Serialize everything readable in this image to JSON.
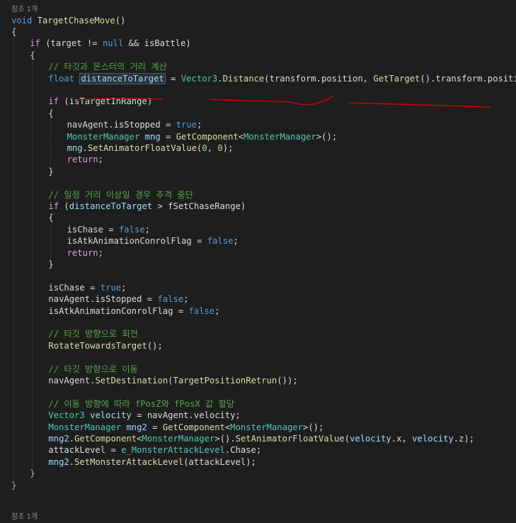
{
  "reference_labels": [
    "참조 1개",
    "참조 1개"
  ],
  "colors": {
    "background": "#1e1e1e",
    "keyword": "#569cd6",
    "control": "#d8a0df",
    "type": "#4ec9b0",
    "method": "#dcdcaa",
    "variable": "#9cdcfe",
    "comment": "#57a64a",
    "number": "#b5cea8",
    "annotation": "#e00000"
  },
  "lines": [
    {
      "indent": 0,
      "tokens": [
        [
          "kw",
          "void"
        ],
        [
          "plain",
          " "
        ],
        [
          "fn",
          "TargetChaseMove"
        ],
        [
          "plain",
          "()"
        ]
      ]
    },
    {
      "indent": 0,
      "tokens": [
        [
          "plain",
          "{"
        ]
      ]
    },
    {
      "indent": 1,
      "tokens": [
        [
          "ctl",
          "if"
        ],
        [
          "plain",
          " (target != "
        ],
        [
          "kw",
          "null"
        ],
        [
          "plain",
          " && isBattle)"
        ]
      ]
    },
    {
      "indent": 1,
      "tokens": [
        [
          "plain",
          "{"
        ]
      ]
    },
    {
      "indent": 2,
      "tokens": [
        [
          "cm",
          "// 타깃과 몬스터의 거리 계산"
        ]
      ]
    },
    {
      "indent": 2,
      "tokens": [
        [
          "kw",
          "float"
        ],
        [
          "plain",
          " "
        ],
        [
          "var",
          "distanceToTarget"
        ],
        [
          "plain",
          " = "
        ],
        [
          "type",
          "Vector3"
        ],
        [
          "plain",
          "."
        ],
        [
          "fn",
          "Distance"
        ],
        [
          "plain",
          "(transform.position, "
        ],
        [
          "fn",
          "GetTarget"
        ],
        [
          "plain",
          "().transform.position);"
        ]
      ]
    },
    {
      "indent": 2,
      "tokens": []
    },
    {
      "indent": 2,
      "tokens": [
        [
          "ctl",
          "if"
        ],
        [
          "plain",
          " (isTargetInRange)"
        ]
      ]
    },
    {
      "indent": 2,
      "tokens": [
        [
          "plain",
          "{"
        ]
      ]
    },
    {
      "indent": 3,
      "tokens": [
        [
          "plain",
          "navAgent.isStopped = "
        ],
        [
          "kw",
          "true"
        ],
        [
          "plain",
          ";"
        ]
      ]
    },
    {
      "indent": 3,
      "tokens": [
        [
          "type",
          "MonsterManager"
        ],
        [
          "plain",
          " "
        ],
        [
          "var",
          "mng"
        ],
        [
          "plain",
          " = "
        ],
        [
          "fn",
          "GetComponent"
        ],
        [
          "plain",
          "<"
        ],
        [
          "type",
          "MonsterManager"
        ],
        [
          "plain",
          ">();"
        ]
      ]
    },
    {
      "indent": 3,
      "tokens": [
        [
          "var",
          "mng"
        ],
        [
          "plain",
          "."
        ],
        [
          "fn",
          "SetAnimatorFloatValue"
        ],
        [
          "plain",
          "("
        ],
        [
          "num",
          "0"
        ],
        [
          "plain",
          ", "
        ],
        [
          "num",
          "0"
        ],
        [
          "plain",
          ");"
        ]
      ]
    },
    {
      "indent": 3,
      "tokens": [
        [
          "ctl",
          "return"
        ],
        [
          "plain",
          ";"
        ]
      ]
    },
    {
      "indent": 2,
      "tokens": [
        [
          "plain",
          "}"
        ]
      ]
    },
    {
      "indent": 2,
      "tokens": []
    },
    {
      "indent": 2,
      "tokens": [
        [
          "cm",
          "// 일정 거리 이상일 경우 추격 중단"
        ]
      ]
    },
    {
      "indent": 2,
      "tokens": [
        [
          "ctl",
          "if"
        ],
        [
          "plain",
          " ("
        ],
        [
          "var",
          "distanceToTarget"
        ],
        [
          "plain",
          " > fSetChaseRange)"
        ]
      ]
    },
    {
      "indent": 2,
      "tokens": [
        [
          "plain",
          "{"
        ]
      ]
    },
    {
      "indent": 3,
      "tokens": [
        [
          "plain",
          "isChase = "
        ],
        [
          "kw",
          "false"
        ],
        [
          "plain",
          ";"
        ]
      ]
    },
    {
      "indent": 3,
      "tokens": [
        [
          "plain",
          "isAtkAnimationConrolFlag = "
        ],
        [
          "kw",
          "false"
        ],
        [
          "plain",
          ";"
        ]
      ]
    },
    {
      "indent": 3,
      "tokens": [
        [
          "ctl",
          "return"
        ],
        [
          "plain",
          ";"
        ]
      ]
    },
    {
      "indent": 2,
      "tokens": [
        [
          "plain",
          "}"
        ]
      ]
    },
    {
      "indent": 2,
      "tokens": []
    },
    {
      "indent": 2,
      "tokens": [
        [
          "plain",
          "isChase = "
        ],
        [
          "kw",
          "true"
        ],
        [
          "plain",
          ";"
        ]
      ]
    },
    {
      "indent": 2,
      "tokens": [
        [
          "plain",
          "navAgent.isStopped = "
        ],
        [
          "kw",
          "false"
        ],
        [
          "plain",
          ";"
        ]
      ]
    },
    {
      "indent": 2,
      "tokens": [
        [
          "plain",
          "isAtkAnimationConrolFlag = "
        ],
        [
          "kw",
          "false"
        ],
        [
          "plain",
          ";"
        ]
      ]
    },
    {
      "indent": 2,
      "tokens": []
    },
    {
      "indent": 2,
      "tokens": [
        [
          "cm",
          "// 타깃 방향으로 회전"
        ]
      ]
    },
    {
      "indent": 2,
      "tokens": [
        [
          "fn",
          "RotateTowardsTarget"
        ],
        [
          "plain",
          "();"
        ]
      ]
    },
    {
      "indent": 2,
      "tokens": []
    },
    {
      "indent": 2,
      "tokens": [
        [
          "cm",
          "// 타깃 방향으로 이동"
        ]
      ]
    },
    {
      "indent": 2,
      "tokens": [
        [
          "plain",
          "navAgent."
        ],
        [
          "fn",
          "SetDestination"
        ],
        [
          "plain",
          "("
        ],
        [
          "fn",
          "TargetPositionRetrun"
        ],
        [
          "plain",
          "());"
        ]
      ]
    },
    {
      "indent": 2,
      "tokens": []
    },
    {
      "indent": 2,
      "tokens": [
        [
          "cm",
          "// 이동 방향에 따라 fPosZ와 fPosX 값 할당"
        ]
      ]
    },
    {
      "indent": 2,
      "tokens": [
        [
          "type",
          "Vector3"
        ],
        [
          "plain",
          " "
        ],
        [
          "var",
          "velocity"
        ],
        [
          "plain",
          " = navAgent.velocity;"
        ]
      ]
    },
    {
      "indent": 2,
      "tokens": [
        [
          "type",
          "MonsterManager"
        ],
        [
          "plain",
          " "
        ],
        [
          "var",
          "mng2"
        ],
        [
          "plain",
          " = "
        ],
        [
          "fn",
          "GetComponent"
        ],
        [
          "plain",
          "<"
        ],
        [
          "type",
          "MonsterManager"
        ],
        [
          "plain",
          ">();"
        ]
      ]
    },
    {
      "indent": 2,
      "tokens": [
        [
          "var",
          "mng2"
        ],
        [
          "plain",
          "."
        ],
        [
          "fn",
          "GetComponent"
        ],
        [
          "plain",
          "<"
        ],
        [
          "type",
          "MonsterManager"
        ],
        [
          "plain",
          ">()."
        ],
        [
          "fn",
          "SetAnimatorFloatValue"
        ],
        [
          "plain",
          "("
        ],
        [
          "var",
          "velocity"
        ],
        [
          "plain",
          ".x, "
        ],
        [
          "var",
          "velocity"
        ],
        [
          "plain",
          ".z);"
        ]
      ]
    },
    {
      "indent": 2,
      "tokens": [
        [
          "plain",
          "attackLevel = "
        ],
        [
          "type",
          "e_MonsterAttackLevel"
        ],
        [
          "plain",
          ".Chase;"
        ]
      ]
    },
    {
      "indent": 2,
      "tokens": [
        [
          "var",
          "mng2"
        ],
        [
          "plain",
          "."
        ],
        [
          "fn",
          "SetMonsterAttackLevel"
        ],
        [
          "plain",
          "(attackLevel);"
        ]
      ]
    },
    {
      "indent": 1,
      "tokens": [
        [
          "plain",
          "}"
        ]
      ]
    },
    {
      "indent": 0,
      "tokens": [
        [
          "plain",
          "}"
        ]
      ]
    }
  ]
}
